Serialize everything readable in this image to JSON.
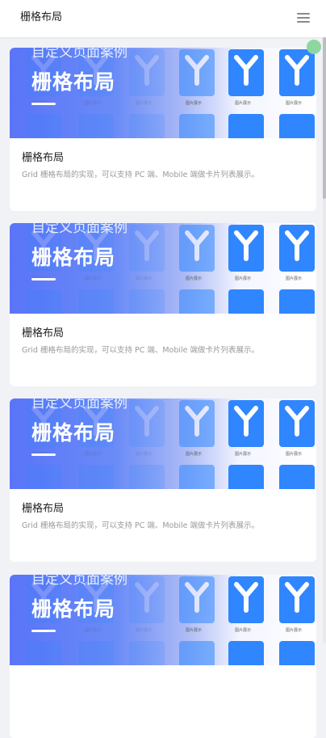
{
  "header": {
    "title": "栅格布局",
    "menu_icon": "hamburger-menu-icon"
  },
  "colors": {
    "banner_gradient_start": "#5a74f7",
    "banner_gradient_end": "#ffffff",
    "tile_blue": "#2f86ff",
    "float_dot": "#8dd6a0",
    "page_bg": "#f0f2f5"
  },
  "cards": [
    {
      "banner_subtitle": "自定义页面案例",
      "banner_title": "栅格布局",
      "title": "栅格布局",
      "description": "Grid 栅格布局的实现，可以支持 PC 端、Mobile 端做卡片列表展示。"
    },
    {
      "banner_subtitle": "自定义页面案例",
      "banner_title": "栅格布局",
      "title": "栅格布局",
      "description": "Grid 栅格布局的实现，可以支持 PC 端、Mobile 端做卡片列表展示。"
    },
    {
      "banner_subtitle": "自定义页面案例",
      "banner_title": "栅格布局",
      "title": "栅格布局",
      "description": "Grid 栅格布局的实现，可以支持 PC 端、Mobile 端做卡片列表展示。"
    },
    {
      "banner_subtitle": "自定义页面案例",
      "banner_title": "栅格布局",
      "title": "",
      "description": ""
    }
  ],
  "tile_caption": "图片展示"
}
